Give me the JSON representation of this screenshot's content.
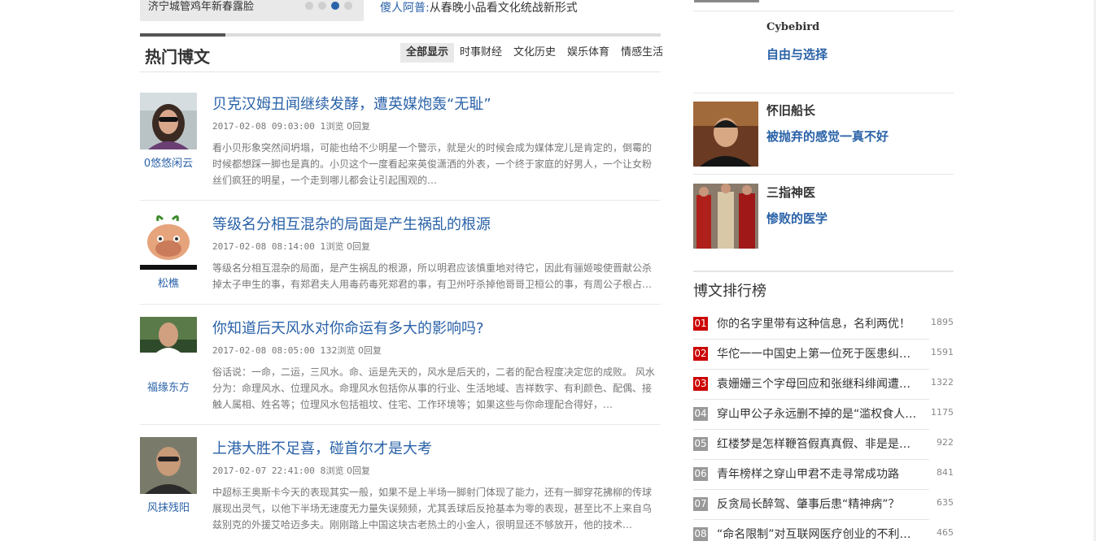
{
  "top": {
    "slider_caption": "济宁城管鸡年新春露脸",
    "headline_prefix": "傻人阿普:",
    "headline_text": "从春晚小品看文化统战新形式"
  },
  "section": {
    "title": "热门博文",
    "tabs": [
      "全部显示",
      "时事财经",
      "文化历史",
      "娱乐体育",
      "情感生活"
    ]
  },
  "posts": [
    {
      "author": "0悠悠闲云",
      "title": "贝克汉姆丑闻继续发酵，遭英媒炮轰“无耻”",
      "meta_time": "2017-02-08 09:03:00",
      "meta_stats": "1浏览 0回复",
      "desc": "看小贝形象突然间坍塌，可能也给不少明星一个警示，就是火的时候会成为媒体宠儿是肯定的，倒霉的时候都想踩一脚也是真的。小贝这个一度看起来英俊潇洒的外表，一个终于家庭的好男人，一个让女粉丝们疯狂的明星，一个走到哪儿都会让引起围观的…"
    },
    {
      "author": "松樵",
      "title": "等级名分相互混杂的局面是产生祸乱的根源",
      "meta_time": "2017-02-08 08:14:00",
      "meta_stats": "1浏览 0回复",
      "desc": "等级名分相互混杂的局面，是产生祸乱的根源，所以明君应该慎重地对待它，因此有骊姬唆使晋献公杀掉太子申生的事，有郑君夫人用毒药毒死郑君的事，有卫州吁杀掉他哥哥卫桓公的事，有周公子根占…"
    },
    {
      "author": "福缘东方",
      "title": "你知道后天风水对你命运有多大的影响吗?",
      "meta_time": "2017-02-08 08:05:00",
      "meta_stats": "132浏览 0回复",
      "desc": "俗话说：一命，二运，三风水。命、运是先天的，风水是后天的，二者的配合程度决定您的成败。 风水分为：命理风水、位理风水。命理风水包括你从事的行业、生活地域、吉祥数字、有利颜色、配偶、接触人属相、姓名等；位理风水包括祖坟、住宅、工作环境等；如果这些与你命理配合得好，…"
    },
    {
      "author": "风抹残阳",
      "title": "上港大胜不足喜，碰首尔才是大考",
      "meta_time": "2017-02-07 22:41:00",
      "meta_stats": "8浏览 0回复",
      "desc": "中超标王奥斯卡今天的表现其实一般，如果不是上半场一脚射门体现了能力，还有一脚穿花拂柳的传球展现出灵气，以他下半场无速度无力量失误频频，尤其丢球后反抢基本为零的表现，甚至比不上来自乌兹别克的外援艾哈迈多夫。刚刚踏上中国这块古老热土的小金人，很明显还不够放开，他的技术…"
    }
  ],
  "sidebar_blogs": [
    {
      "name": "Cybebird",
      "link": "自由与选择"
    },
    {
      "name": "怀旧船长",
      "link": "被抛弃的感觉一真不好"
    },
    {
      "name": "三指神医",
      "link": "惨败的医学"
    }
  ],
  "ranking": {
    "title": "博文排行榜",
    "items": [
      {
        "num": "01",
        "text": "你的名字里带有这种信息，名利两优！",
        "count": "1895",
        "hot": true
      },
      {
        "num": "02",
        "text": "华佗一一中国史上第一位死于医患纠纷的医生",
        "count": "1591",
        "hot": true
      },
      {
        "num": "03",
        "text": "袁姗姗三个字母回应和张继科绯闻遭网友吐槽",
        "count": "1322",
        "hot": true
      },
      {
        "num": "04",
        "text": "穿山甲公子永远删不掉的是“滥权食人”的事实",
        "count": "1175",
        "hot": false
      },
      {
        "num": "05",
        "text": "红楼梦是怎样鞭笞假真真假、非是是非的",
        "count": "922",
        "hot": false
      },
      {
        "num": "06",
        "text": "青年榜样之穿山甲君不走寻常成功路",
        "count": "841",
        "hot": false
      },
      {
        "num": "07",
        "text": "反贪局长醉驾、肇事后患“精神病”？",
        "count": "635",
        "hot": false
      },
      {
        "num": "08",
        "text": "“命名限制”对互联网医疗创业的不利影响",
        "count": "465",
        "hot": false
      }
    ]
  }
}
